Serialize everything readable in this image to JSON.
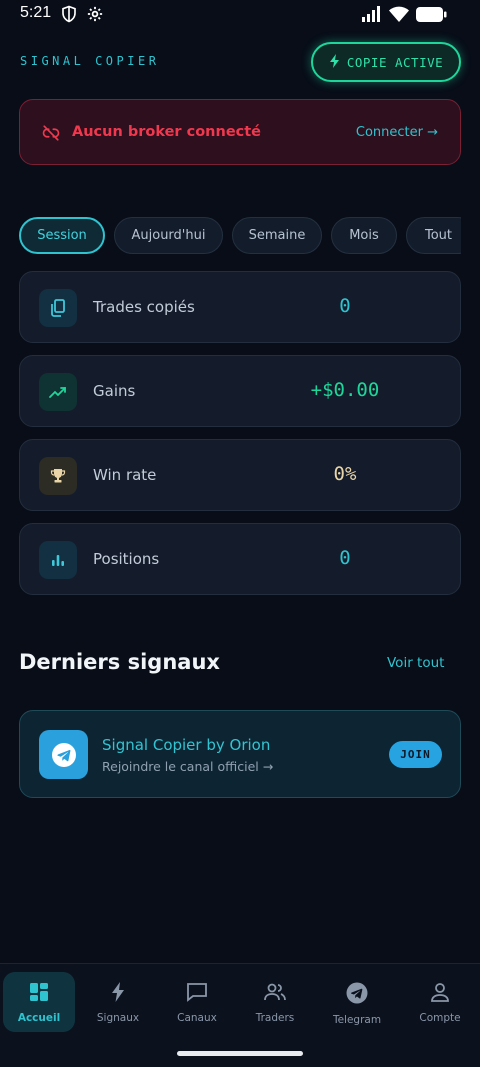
{
  "status_bar": {
    "time": "5:21"
  },
  "header": {
    "app_title": "SIGNAL COPIER",
    "copie_button": "COPIE ACTIVE"
  },
  "broker_banner": {
    "message": "Aucun broker connecté",
    "link": "Connecter →"
  },
  "period_tabs": [
    "Session",
    "Aujourd'hui",
    "Semaine",
    "Mois",
    "Tout"
  ],
  "stats": [
    {
      "label": "Trades copiés",
      "value": "0"
    },
    {
      "label": "Gains",
      "value": "+$0.00"
    },
    {
      "label": "Win rate",
      "value": "0%"
    },
    {
      "label": "Positions",
      "value": "0"
    }
  ],
  "signals_section": {
    "title": "Derniers signaux",
    "see_all": "Voir tout"
  },
  "signal_card": {
    "title": "Signal Copier by Orion",
    "subtitle": "Rejoindre le canal officiel →",
    "join": "JOIN"
  },
  "bottom_nav": [
    "Accueil",
    "Signaux",
    "Canaux",
    "Traders",
    "Telegram",
    "Compte"
  ],
  "colors": {
    "accent": "#2fc3cf",
    "green": "#1fd69a",
    "danger": "#f0384f",
    "gold": "#e9d5a8",
    "telegram": "#2aa1dd"
  }
}
